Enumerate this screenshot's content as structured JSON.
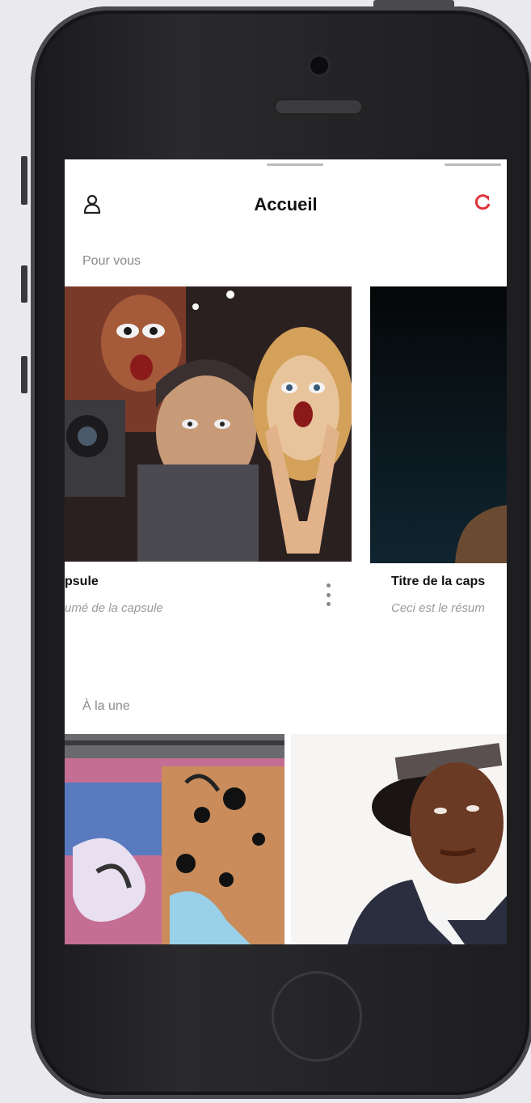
{
  "app": {
    "nav_title": "Accueil",
    "left_icon": "user-icon",
    "right_icon": "refresh-icon",
    "accent_color": "#e0323a"
  },
  "sections": {
    "for_you": {
      "label": "Pour vous",
      "cards": [
        {
          "title": "psule",
          "description": "umé de la capsule",
          "image": "comic-art-screaming-faces"
        },
        {
          "title": "Titre de la caps",
          "description": "Ceci est le résum",
          "image": "dark-photo-hand"
        }
      ]
    },
    "featured": {
      "label": "À la une",
      "cards": [
        {
          "image": "graffiti-wall"
        },
        {
          "image": "portrait-bandana"
        }
      ]
    }
  }
}
